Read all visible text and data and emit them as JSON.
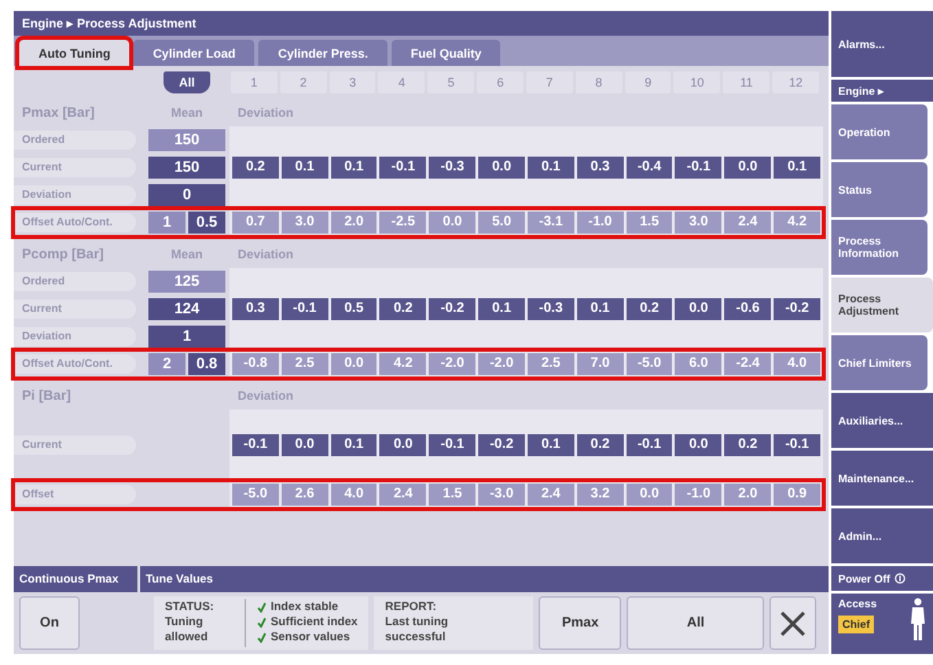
{
  "breadcrumb": "Engine ▸ Process Adjustment",
  "tabs": [
    {
      "label": "Auto Tuning",
      "selected": true,
      "highlighted": true
    },
    {
      "label": "Cylinder Load",
      "selected": false,
      "highlighted": false
    },
    {
      "label": "Cylinder Press.",
      "selected": false,
      "highlighted": false
    },
    {
      "label": "Fuel Quality",
      "selected": false,
      "highlighted": false
    }
  ],
  "columns": [
    {
      "label": "All",
      "selected": true
    },
    {
      "label": "1",
      "selected": false
    },
    {
      "label": "2",
      "selected": false
    },
    {
      "label": "3",
      "selected": false
    },
    {
      "label": "4",
      "selected": false
    },
    {
      "label": "5",
      "selected": false
    },
    {
      "label": "6",
      "selected": false
    },
    {
      "label": "7",
      "selected": false
    },
    {
      "label": "8",
      "selected": false
    },
    {
      "label": "9",
      "selected": false
    },
    {
      "label": "10",
      "selected": false
    },
    {
      "label": "11",
      "selected": false
    },
    {
      "label": "12",
      "selected": false
    }
  ],
  "sections": [
    {
      "title": "Pmax [Bar]",
      "mean_header": "Mean",
      "deviation_header": "Deviation",
      "rows": [
        {
          "kind": "ordered",
          "label": "Ordered",
          "mean": [
            "150"
          ],
          "highlighted": false
        },
        {
          "kind": "current",
          "label": "Current",
          "mean": [
            "150"
          ],
          "values": [
            "0.2",
            "0.1",
            "0.1",
            "-0.1",
            "-0.3",
            "0.0",
            "0.1",
            "0.3",
            "-0.4",
            "-0.1",
            "0.0",
            "0.1"
          ],
          "highlighted": false
        },
        {
          "kind": "deviation",
          "label": "Deviation",
          "mean": [
            "0"
          ],
          "highlighted": false
        },
        {
          "kind": "offset",
          "label": "Offset Auto/Cont.",
          "mean": [
            "1",
            "0.5"
          ],
          "values": [
            "0.7",
            "3.0",
            "2.0",
            "-2.5",
            "0.0",
            "5.0",
            "-3.1",
            "-1.0",
            "1.5",
            "3.0",
            "2.4",
            "4.2"
          ],
          "highlighted": true
        }
      ]
    },
    {
      "title": "Pcomp [Bar]",
      "mean_header": "Mean",
      "deviation_header": "Deviation",
      "rows": [
        {
          "kind": "ordered",
          "label": "Ordered",
          "mean": [
            "125"
          ],
          "highlighted": false
        },
        {
          "kind": "current",
          "label": "Current",
          "mean": [
            "124"
          ],
          "values": [
            "0.3",
            "-0.1",
            "0.5",
            "0.2",
            "-0.2",
            "0.1",
            "-0.3",
            "0.1",
            "0.2",
            "0.0",
            "-0.6",
            "-0.2"
          ],
          "highlighted": false
        },
        {
          "kind": "deviation",
          "label": "Deviation",
          "mean": [
            "1"
          ],
          "highlighted": false
        },
        {
          "kind": "offset",
          "label": "Offset Auto/Cont.",
          "mean": [
            "2",
            "0.8"
          ],
          "values": [
            "-0.8",
            "2.5",
            "0.0",
            "4.2",
            "-2.0",
            "-2.0",
            "2.5",
            "7.0",
            "-5.0",
            "6.0",
            "-2.4",
            "4.0"
          ],
          "highlighted": true
        }
      ]
    },
    {
      "title": "Pi [Bar]",
      "deviation_header": "Deviation",
      "rows": [
        {
          "kind": "current",
          "label": "Current",
          "values": [
            "-0.1",
            "0.0",
            "0.1",
            "0.0",
            "-0.1",
            "-0.2",
            "0.1",
            "0.2",
            "-0.1",
            "0.0",
            "0.2",
            "-0.1"
          ],
          "highlighted": false
        },
        {
          "kind": "offset",
          "label": "Offset",
          "values": [
            "-5.0",
            "2.6",
            "4.0",
            "2.4",
            "1.5",
            "-3.0",
            "2.4",
            "3.2",
            "0.0",
            "-1.0",
            "2.0",
            "0.9"
          ],
          "highlighted": true
        }
      ]
    }
  ],
  "continuous_pmax": {
    "title": "Continuous Pmax",
    "button": "On"
  },
  "tune_values": {
    "title": "Tune Values",
    "status_label": "STATUS:",
    "status_text": "Tuning allowed",
    "checks": [
      {
        "label": "Index stable",
        "ok": true
      },
      {
        "label": "Sufficient index",
        "ok": true
      },
      {
        "label": "Sensor values",
        "ok": true
      }
    ],
    "report_label": "REPORT:",
    "report_text": "Last tuning successful",
    "buttons": [
      "Pmax",
      "All"
    ]
  },
  "sidebar": [
    {
      "kind": "menu",
      "label": "Alarms..."
    },
    {
      "kind": "header",
      "label": "Engine ▸"
    },
    {
      "kind": "tab",
      "label": "Operation",
      "selected": false
    },
    {
      "kind": "tab",
      "label": "Status",
      "selected": false
    },
    {
      "kind": "tab",
      "label": "Process Information",
      "selected": false
    },
    {
      "kind": "tab",
      "label": "Process Adjustment",
      "selected": true
    },
    {
      "kind": "tab",
      "label": "Chief Limiters",
      "selected": false
    },
    {
      "kind": "menu",
      "label": "Auxiliaries..."
    },
    {
      "kind": "menu",
      "label": "Maintenance..."
    },
    {
      "kind": "menu",
      "label": "Admin..."
    },
    {
      "kind": "power",
      "label": "Power Off"
    },
    {
      "kind": "access",
      "label": "Access",
      "badge": "Chief"
    }
  ]
}
